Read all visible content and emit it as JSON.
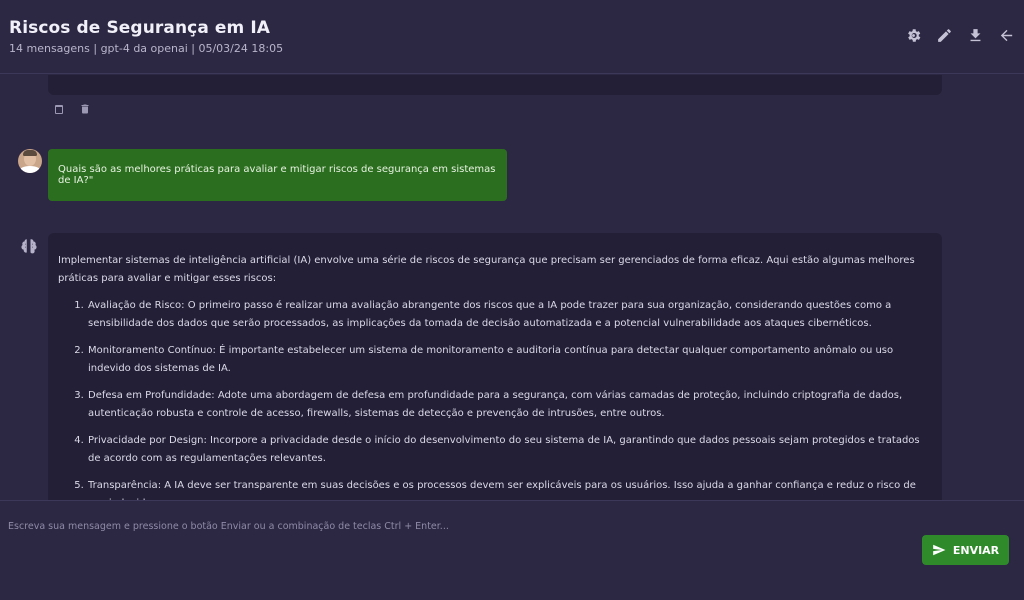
{
  "header": {
    "title": "Riscos de Segurança em IA",
    "subtitle": "14 mensagens | gpt-4 da openai | 05/03/24 18:05",
    "actions": [
      "gear-icon",
      "pencil-icon",
      "download-icon",
      "arrow-left-icon"
    ]
  },
  "user_message": {
    "text": "Quais são as melhores práticas para avaliar e mitigar riscos de segurança em sistemas de IA?\""
  },
  "assistant_message": {
    "intro": "Implementar sistemas de inteligência artificial (IA) envolve uma série de riscos de segurança que precisam ser gerenciados de forma eficaz. Aqui estão algumas melhores práticas para avaliar e mitigar esses riscos:",
    "items": [
      "Avaliação de Risco: O primeiro passo é realizar uma avaliação abrangente dos riscos que a IA pode trazer para sua organização, considerando questões como a sensibilidade dos dados que serão processados, as implicações da tomada de decisão automatizada e a potencial vulnerabilidade aos ataques cibernéticos.",
      "Monitoramento Contínuo: É importante estabelecer um sistema de monitoramento e auditoria contínua para detectar qualquer comportamento anômalo ou uso indevido dos sistemas de IA.",
      "Defesa em Profundidade: Adote uma abordagem de defesa em profundidade para a segurança, com várias camadas de proteção, incluindo criptografia de dados, autenticação robusta e controle de acesso, firewalls, sistemas de detecção e prevenção de intrusões, entre outros.",
      "Privacidade por Design: Incorpore a privacidade desde o início do desenvolvimento do seu sistema de IA, garantindo que dados pessoais sejam protegidos e tratados de acordo com as regulamentações relevantes.",
      "Transparência: A IA deve ser transparente em suas decisões e os processos devem ser explicáveis para os usuários. Isso ajuda a ganhar confiança e reduz o risco de uso indevido."
    ]
  },
  "composer": {
    "placeholder": "Escreva sua mensagem e pressione o botão Enviar ou a combinação de teclas Ctrl + Enter...",
    "send_label": "ENVIAR"
  },
  "colors": {
    "background": "#2c2843",
    "card": "#221f36",
    "user_bubble": "#2c6e1f",
    "send_button": "#2f8a2a"
  }
}
